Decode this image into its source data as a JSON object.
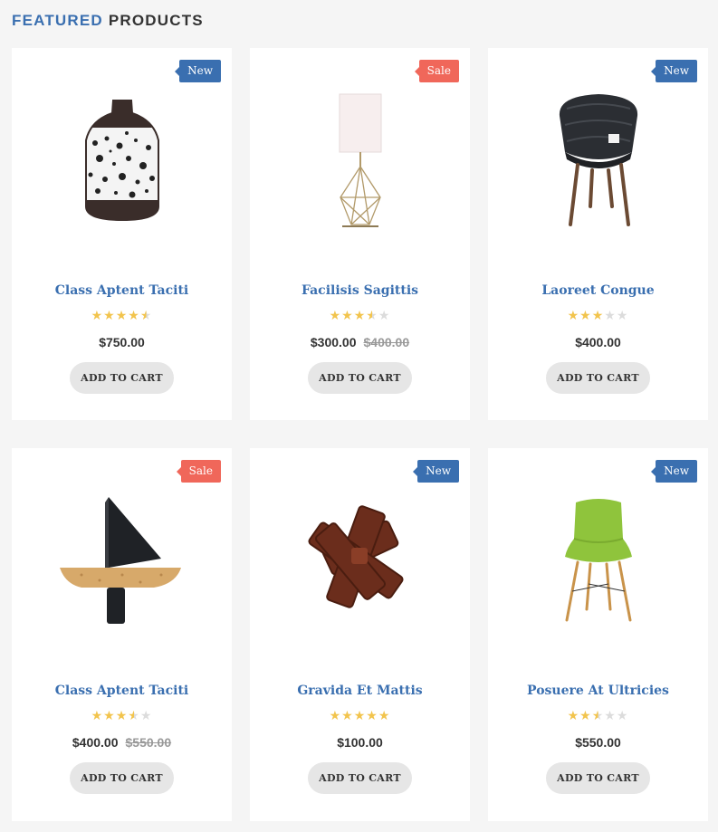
{
  "section": {
    "title_accent": "FEATURED",
    "title_rest": "PRODUCTS"
  },
  "colors": {
    "accent": "#3a6fb0",
    "badge_new": "#3a6fb0",
    "badge_sale": "#f0675a",
    "star": "#f2c44d"
  },
  "products": [
    {
      "name": "Class Aptent Taciti",
      "badge": "New",
      "price": "$750.00",
      "old_price": "",
      "rating": 4.5,
      "cart_label": "ADD TO CART",
      "image": "speckled-vase"
    },
    {
      "name": "Facilisis Sagittis",
      "badge": "Sale",
      "price": "$300.00",
      "old_price": "$400.00",
      "rating": 3.5,
      "cart_label": "ADD TO CART",
      "image": "geometric-lamp"
    },
    {
      "name": "Laoreet Congue",
      "badge": "New",
      "price": "$400.00",
      "old_price": "",
      "rating": 3,
      "cart_label": "ADD TO CART",
      "image": "black-chair"
    },
    {
      "name": "Class Aptent Taciti",
      "badge": "Sale",
      "price": "$400.00",
      "old_price": "$550.00",
      "rating": 3.5,
      "cart_label": "ADD TO CART",
      "image": "cork-boat"
    },
    {
      "name": "Gravida Et Mattis",
      "badge": "New",
      "price": "$100.00",
      "old_price": "",
      "rating": 5,
      "cart_label": "ADD TO CART",
      "image": "wooden-puzzle"
    },
    {
      "name": "Posuere At Ultricies",
      "badge": "New",
      "price": "$550.00",
      "old_price": "",
      "rating": 2.5,
      "cart_label": "ADD TO CART",
      "image": "green-chair"
    }
  ]
}
